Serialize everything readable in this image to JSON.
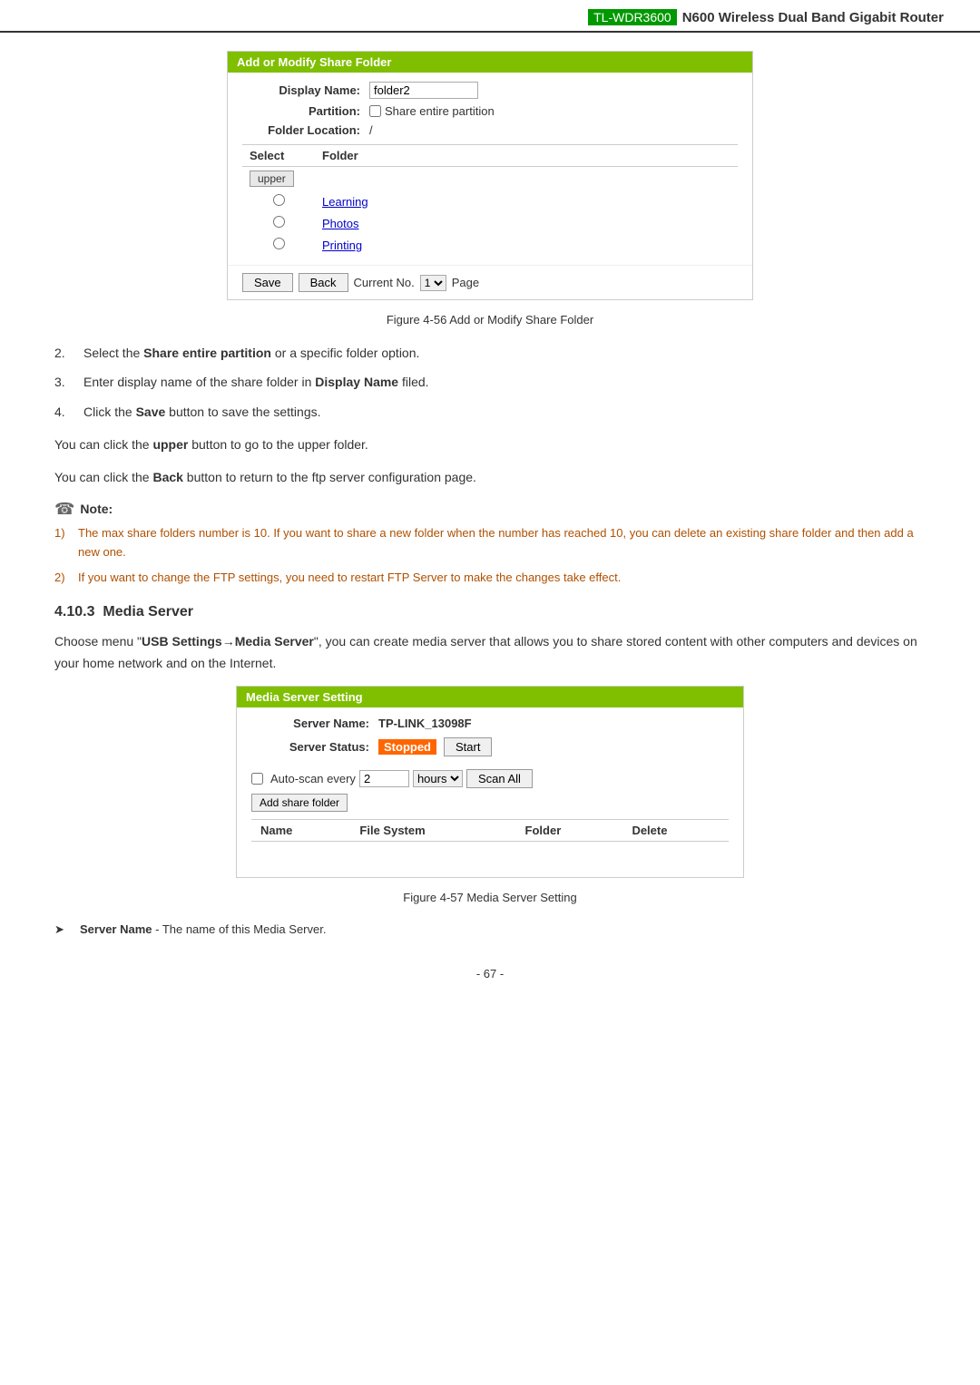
{
  "header": {
    "model": "TL-WDR3600",
    "title": "N600 Wireless Dual Band Gigabit Router"
  },
  "panel1": {
    "title": "Add or Modify Share Folder",
    "fields": {
      "display_name_label": "Display Name:",
      "display_name_value": "folder2",
      "partition_label": "Partition:",
      "partition_checkbox_label": "Share entire partition",
      "folder_location_label": "Folder Location:",
      "folder_location_value": "/"
    },
    "table": {
      "col_select": "Select",
      "col_folder": "Folder",
      "upper_btn": "upper",
      "rows": [
        {
          "folder": "Learning"
        },
        {
          "folder": "Photos"
        },
        {
          "folder": "Printing"
        }
      ]
    },
    "footer": {
      "save": "Save",
      "back": "Back",
      "current_no_label": "Current No.",
      "page_value": "1",
      "page_label": "Page"
    }
  },
  "figure1": {
    "caption": "Figure 4-56 Add or Modify Share Folder"
  },
  "steps": [
    {
      "num": "2.",
      "text_plain": "Select the ",
      "text_bold": "Share entire partition",
      "text_after": " or a specific folder option."
    },
    {
      "num": "3.",
      "text_plain": "Enter display name of the share folder in ",
      "text_bold": "Display Name",
      "text_after": " filed."
    },
    {
      "num": "4.",
      "text_plain": "Click the ",
      "text_bold": "Save",
      "text_after": " button to save the settings."
    }
  ],
  "para1": {
    "text_plain": "You can click the ",
    "text_bold": "upper",
    "text_after": " button to go to the upper folder."
  },
  "para2": {
    "text_plain": "You can click the ",
    "text_bold": "Back",
    "text_after": " button to return to the ftp server configuration page."
  },
  "note": {
    "label": "Note:",
    "items": [
      {
        "num": "1)",
        "text": "The max share folders number is 10. If you want to share a new folder when the number has reached 10, you can delete an existing share folder and then add a new one."
      },
      {
        "num": "2)",
        "text": "If you want to change the FTP settings, you need to restart FTP Server to make the changes take effect."
      }
    ]
  },
  "section": {
    "number": "4.10.3",
    "title": "Media Server"
  },
  "intro": {
    "text_plain": "Choose menu “",
    "text_bold": "USB Settings→Media Server",
    "text_after": "”, you can create media server that allows you to share stored content with other computers and devices on your home network and on the Internet."
  },
  "panel2": {
    "title": "Media Server Setting",
    "server_name_label": "Server Name:",
    "server_name_value": "TP-LINK_13098F",
    "server_status_label": "Server Status:",
    "server_status_value": "Stopped",
    "start_btn": "Start",
    "autoscan_label": "Auto-scan every",
    "autoscan_value": "2 hours",
    "autoscan_hours": "hours",
    "scan_all_btn": "Scan All",
    "add_share_btn": "Add share folder",
    "table": {
      "col_name": "Name",
      "col_filesystem": "File System",
      "col_folder": "Folder",
      "col_delete": "Delete"
    }
  },
  "figure2": {
    "caption": "Figure 4-57 Media Server Setting"
  },
  "server_name_desc": {
    "label": "Server Name",
    "text": " - The name of this Media Server."
  },
  "page_number": "- 67 -"
}
